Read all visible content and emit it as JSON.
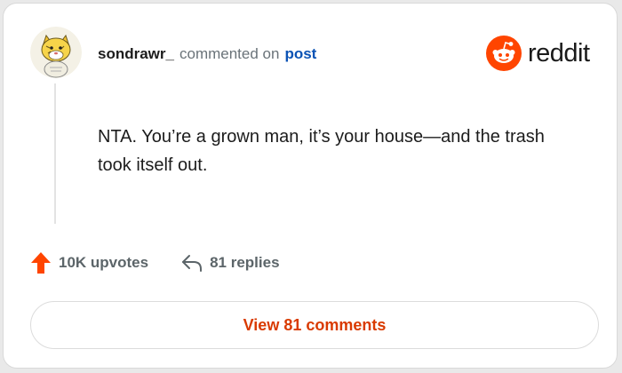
{
  "comment": {
    "username": "sondrawr_",
    "action_text": "commented on",
    "target_link": "post",
    "body": "NTA. You’re a grown man, it’s your house—and the trash took itself out."
  },
  "brand": {
    "wordmark": "reddit",
    "color": "#ff4500"
  },
  "stats": {
    "upvotes": "10K upvotes",
    "replies": "81 replies"
  },
  "cta": {
    "view_comments": "View 81 comments"
  },
  "icons": {
    "avatar": "avatar-illustration",
    "logo": "reddit-snoo-icon",
    "upvote": "upvote-arrow-icon",
    "reply": "reply-arrow-icon"
  },
  "colors": {
    "accent": "#ff4500",
    "link": "#0b53b5",
    "cta_text": "#d93a00"
  }
}
